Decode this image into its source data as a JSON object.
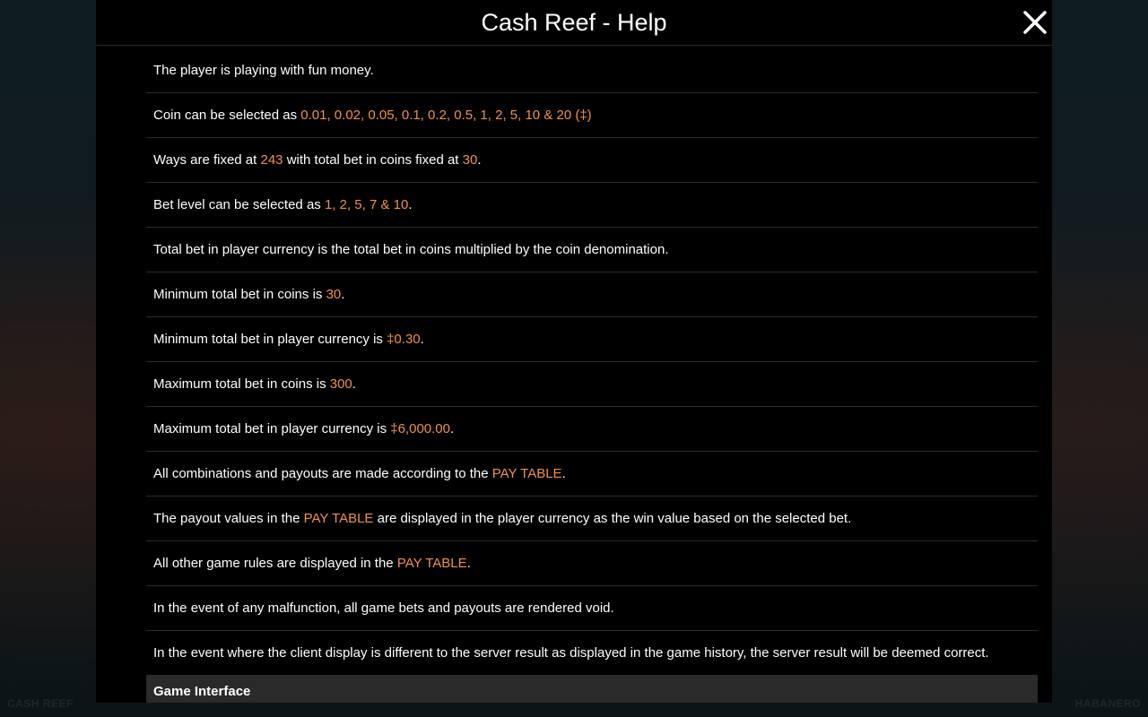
{
  "background": {
    "left_text": "CASH REEF",
    "right_text": "HABANERO"
  },
  "header": {
    "title": "Cash Reef - Help",
    "close_icon": "close-icon"
  },
  "rules": [
    [
      {
        "t": "The player is playing with fun money."
      }
    ],
    [
      {
        "t": "Coin can be selected as "
      },
      {
        "t": "0.01, 0.02, 0.05, 0.1, 0.2, 0.5, 1, 2, 5, 10 & 20 (‡)",
        "hl": true
      }
    ],
    [
      {
        "t": "Ways are fixed at "
      },
      {
        "t": "243",
        "hl": true
      },
      {
        "t": " with total bet in coins fixed at "
      },
      {
        "t": "30",
        "hl": true
      },
      {
        "t": "."
      }
    ],
    [
      {
        "t": "Bet level can be selected as "
      },
      {
        "t": "1, 2, 5, 7 & 10",
        "hl": true
      },
      {
        "t": "."
      }
    ],
    [
      {
        "t": "Total bet in player currency is the total bet in coins multiplied by the coin denomination."
      }
    ],
    [
      {
        "t": "Minimum total bet in coins is "
      },
      {
        "t": "30",
        "hl": true
      },
      {
        "t": "."
      }
    ],
    [
      {
        "t": "Minimum total bet in player currency is "
      },
      {
        "t": "‡0.30",
        "hl": true
      },
      {
        "t": "."
      }
    ],
    [
      {
        "t": "Maximum total bet in coins is "
      },
      {
        "t": "300",
        "hl": true
      },
      {
        "t": "."
      }
    ],
    [
      {
        "t": "Maximum total bet in player currency is "
      },
      {
        "t": "‡6,000.00",
        "hl": true
      },
      {
        "t": "."
      }
    ],
    [
      {
        "t": "All combinations and payouts are made according to the "
      },
      {
        "t": "PAY TABLE",
        "hl": true
      },
      {
        "t": "."
      }
    ],
    [
      {
        "t": "The payout values in the "
      },
      {
        "t": "PAY TABLE",
        "hl": true
      },
      {
        "t": " are displayed in the player currency as the win value based on the selected bet."
      }
    ],
    [
      {
        "t": "All other game rules are displayed in the "
      },
      {
        "t": "PAY TABLE",
        "hl": true
      },
      {
        "t": "."
      }
    ],
    [
      {
        "t": "In the event of any malfunction, all game bets and payouts are rendered void."
      }
    ],
    [
      {
        "t": "In the event where the client display is different to the server result as displayed in the game history, the server result will be deemed correct."
      }
    ]
  ],
  "section": {
    "title": "Game Interface"
  },
  "colors": {
    "highlight": "#f0924a",
    "panel": "#000000",
    "divider": "#2b2b2b"
  }
}
